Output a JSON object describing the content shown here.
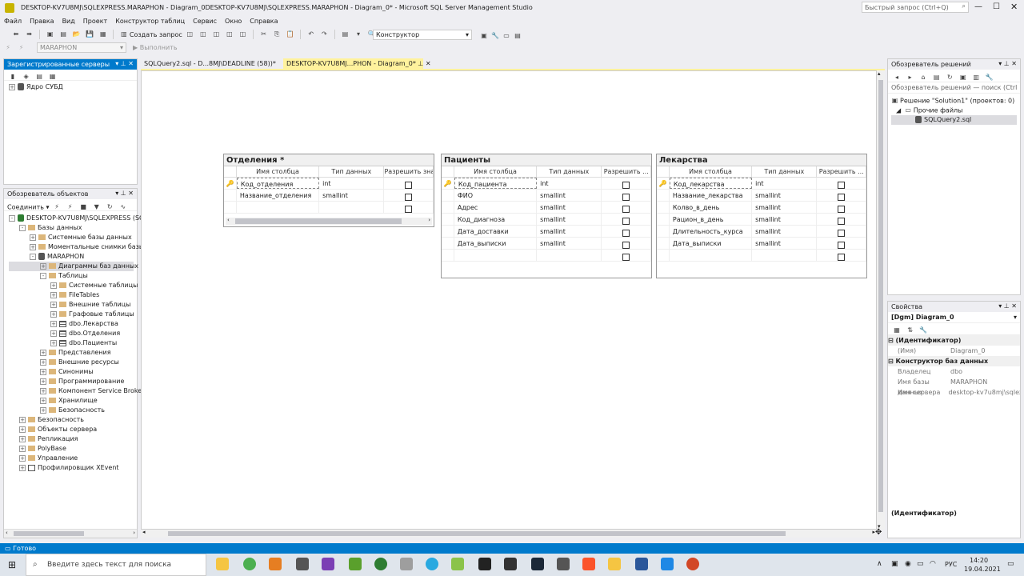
{
  "window": {
    "title": "DESKTOP-KV7U8MJ\\SQLEXPRESS.MARAPHON - Diagram_0DESKTOP-KV7U8MJ\\SQLEXPRESS.MARAPHON - Diagram_0* - Microsoft SQL Server Management Studio",
    "quick_launch_placeholder": "Быстрый запрос (Ctrl+Q)"
  },
  "menu": [
    "Файл",
    "Правка",
    "Вид",
    "Проект",
    "Конструктор таблиц",
    "Сервис",
    "Окно",
    "Справка"
  ],
  "toolbar": {
    "new_query": "Создать запрос",
    "config_value": "Конструктор",
    "db_value": "MARAPHON",
    "execute": "Выполнить"
  },
  "registered_servers": {
    "title": "Зарегистрированные серверы",
    "items": [
      {
        "label": "Ядро СУБД"
      }
    ]
  },
  "object_explorer": {
    "title": "Обозреватель объектов",
    "connect": "Соединить",
    "tree": [
      {
        "label": "DESKTOP-KV7U8MJ\\SQLEXPRESS (SQL",
        "level": 0,
        "exp": "-",
        "icon": "server"
      },
      {
        "label": "Базы данных",
        "level": 1,
        "exp": "-",
        "icon": "folder"
      },
      {
        "label": "Системные базы данных",
        "level": 2,
        "exp": "+",
        "icon": "folder"
      },
      {
        "label": "Моментальные снимки базы д",
        "level": 2,
        "exp": "+",
        "icon": "folder"
      },
      {
        "label": "MARAPHON",
        "level": 2,
        "exp": "-",
        "icon": "db"
      },
      {
        "label": "Диаграммы баз данных",
        "level": 3,
        "exp": "+",
        "icon": "folder",
        "selected": true
      },
      {
        "label": "Таблицы",
        "level": 3,
        "exp": "-",
        "icon": "folder"
      },
      {
        "label": "Системные таблицы",
        "level": 4,
        "exp": "+",
        "icon": "folder"
      },
      {
        "label": "FileTables",
        "level": 4,
        "exp": "+",
        "icon": "folder"
      },
      {
        "label": "Внешние таблицы",
        "level": 4,
        "exp": "+",
        "icon": "folder"
      },
      {
        "label": "Графовые таблицы",
        "level": 4,
        "exp": "+",
        "icon": "folder"
      },
      {
        "label": "dbo.Лекарства",
        "level": 4,
        "exp": "+",
        "icon": "table"
      },
      {
        "label": "dbo.Отделения",
        "level": 4,
        "exp": "+",
        "icon": "table"
      },
      {
        "label": "dbo.Пациенты",
        "level": 4,
        "exp": "+",
        "icon": "table"
      },
      {
        "label": "Представления",
        "level": 3,
        "exp": "+",
        "icon": "folder"
      },
      {
        "label": "Внешние ресурсы",
        "level": 3,
        "exp": "+",
        "icon": "folder"
      },
      {
        "label": "Синонимы",
        "level": 3,
        "exp": "+",
        "icon": "folder"
      },
      {
        "label": "Программирование",
        "level": 3,
        "exp": "+",
        "icon": "folder"
      },
      {
        "label": "Компонент Service Broker",
        "level": 3,
        "exp": "+",
        "icon": "folder"
      },
      {
        "label": "Хранилище",
        "level": 3,
        "exp": "+",
        "icon": "folder"
      },
      {
        "label": "Безопасность",
        "level": 3,
        "exp": "+",
        "icon": "folder"
      },
      {
        "label": "Безопасность",
        "level": 1,
        "exp": "+",
        "icon": "folder"
      },
      {
        "label": "Объекты сервера",
        "level": 1,
        "exp": "+",
        "icon": "folder"
      },
      {
        "label": "Репликация",
        "level": 1,
        "exp": "+",
        "icon": "folder"
      },
      {
        "label": "PolyBase",
        "level": 1,
        "exp": "+",
        "icon": "folder"
      },
      {
        "label": "Управление",
        "level": 1,
        "exp": "+",
        "icon": "folder"
      },
      {
        "label": "Профилировщик XEvent",
        "level": 1,
        "exp": "+",
        "icon": "xevent"
      }
    ]
  },
  "tabs": [
    {
      "label": "SQLQuery2.sql - D...8MJ\\DEADLINE (58))*",
      "active": false
    },
    {
      "label": "DESKTOP-KV7U8MJ...PHON - Diagram_0*",
      "active": true
    }
  ],
  "diagram": {
    "col_headers": [
      "Имя столбца",
      "Тип данных",
      "Разрешить зна"
    ],
    "col_headers_short": [
      "Имя столбца",
      "Тип данных",
      "Разрешить ..."
    ],
    "tables": [
      {
        "name": "Отделения *",
        "rows": [
          [
            "Код_отделения",
            "int"
          ],
          [
            "Название_отделения",
            "smallint"
          ]
        ]
      },
      {
        "name": "Пациенты",
        "rows": [
          [
            "Код_пациента",
            "int"
          ],
          [
            "ФИО",
            "smallint"
          ],
          [
            "Адрес",
            "smallint"
          ],
          [
            "Код_диагноза",
            "smallint"
          ],
          [
            "Дата_доставки",
            "smallint"
          ],
          [
            "Дата_выписки",
            "smallint"
          ]
        ]
      },
      {
        "name": "Лекарства",
        "rows": [
          [
            "Код_лекарства",
            "int"
          ],
          [
            "Название_лекарства",
            "smallint"
          ],
          [
            "Колво_в_день",
            "smallint"
          ],
          [
            "Рацион_в_день",
            "smallint"
          ],
          [
            "Длительность_курса",
            "smallint"
          ],
          [
            "Дата_выписки",
            "smallint"
          ]
        ]
      }
    ]
  },
  "solution_explorer": {
    "title": "Обозреватель решений",
    "search_placeholder": "Обозреватель решений — поиск (Ctrl",
    "items": [
      {
        "label": "Решение \"Solution1\"  (проектов: 0)"
      },
      {
        "label": "Прочие файлы"
      },
      {
        "label": "SQLQuery2.sql"
      }
    ]
  },
  "properties": {
    "title": "Свойства",
    "object": "[Dgm] Diagram_0",
    "cat1": "(Идентификатор)",
    "name_key": "(Имя)",
    "name_val": "Diagram_0",
    "cat2": "Конструктор баз данных",
    "owner_key": "Владелец",
    "owner_val": "dbo",
    "dbname_key": "Имя базы данных",
    "dbname_val": "MARAPHON",
    "server_key": "Имя сервера",
    "server_val": "desktop-kv7u8mj\\sqlex",
    "footer": "(Идентификатор)"
  },
  "status": {
    "text": "Готово"
  },
  "taskbar": {
    "search_placeholder": "Введите здесь текст для поиска",
    "lang": "РУС",
    "time": "14:20",
    "date": "19.04.2021"
  },
  "colors": {
    "accent": "#007acc",
    "active_tab": "#fff29d",
    "status_bar": "#007acc"
  }
}
